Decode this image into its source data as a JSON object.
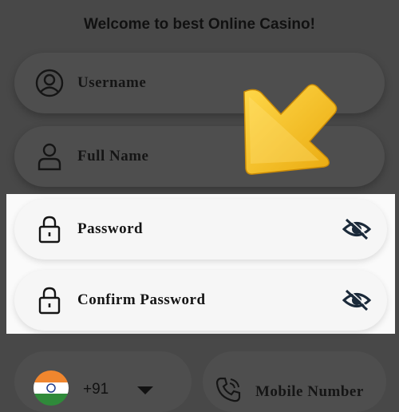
{
  "header": {
    "title": "Welcome to best Online Casino!"
  },
  "form": {
    "username": {
      "label": "Username",
      "icon": "user-circle-icon"
    },
    "full_name": {
      "label": "Full  Name",
      "icon": "user-icon"
    },
    "password": {
      "label": "Password",
      "icon": "lock-icon",
      "toggle_icon": "eye-slash-icon"
    },
    "confirm_password": {
      "label": "Confirm  Password",
      "icon": "lock-icon",
      "toggle_icon": "eye-slash-icon"
    },
    "country_code": {
      "value": "+91",
      "icon": "india-flag-icon"
    },
    "mobile": {
      "label": "Mobile  Number",
      "icon": "phone-icon"
    }
  },
  "overlay": {
    "arrow_icon": "yellow-arrow-icon",
    "arrow_color": "#f7c21a"
  }
}
